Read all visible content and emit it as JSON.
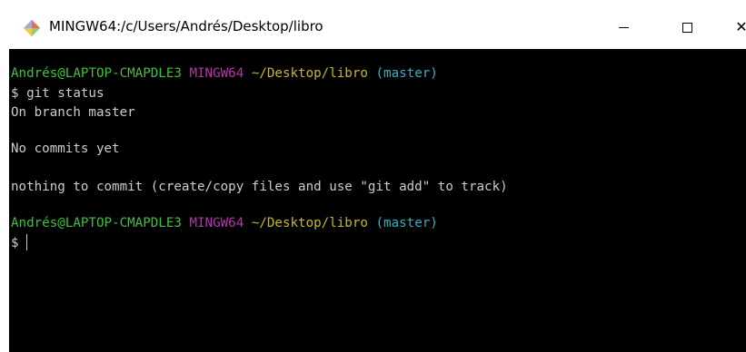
{
  "window": {
    "title": "MINGW64:/c/Users/Andrés/Desktop/libro",
    "icons": {
      "app": "git-bash-diamond-icon",
      "minimize": "minimize-icon",
      "maximize": "maximize-icon",
      "close": "close-icon"
    },
    "close_glyph": "✕"
  },
  "terminal": {
    "background": "#000000",
    "colors": {
      "user": "#3fc23a",
      "shell": "#c02fb7",
      "path": "#c8b91e",
      "branch": "#2ab6c8",
      "text": "#cccccc"
    },
    "prompt1": {
      "user_host": "Andrés@LAPTOP-CMAPDLE3",
      "shell": "MINGW64",
      "path": "~/Desktop/libro",
      "branch": "(master)"
    },
    "command1": "$ git status",
    "output": [
      "On branch master",
      "No commits yet",
      "nothing to commit (create/copy files and use \"git add\" to track)"
    ],
    "prompt2": {
      "user_host": "Andrés@LAPTOP-CMAPDLE3",
      "shell": "MINGW64",
      "path": "~/Desktop/libro",
      "branch": "(master)"
    },
    "input_prompt": "$ "
  }
}
